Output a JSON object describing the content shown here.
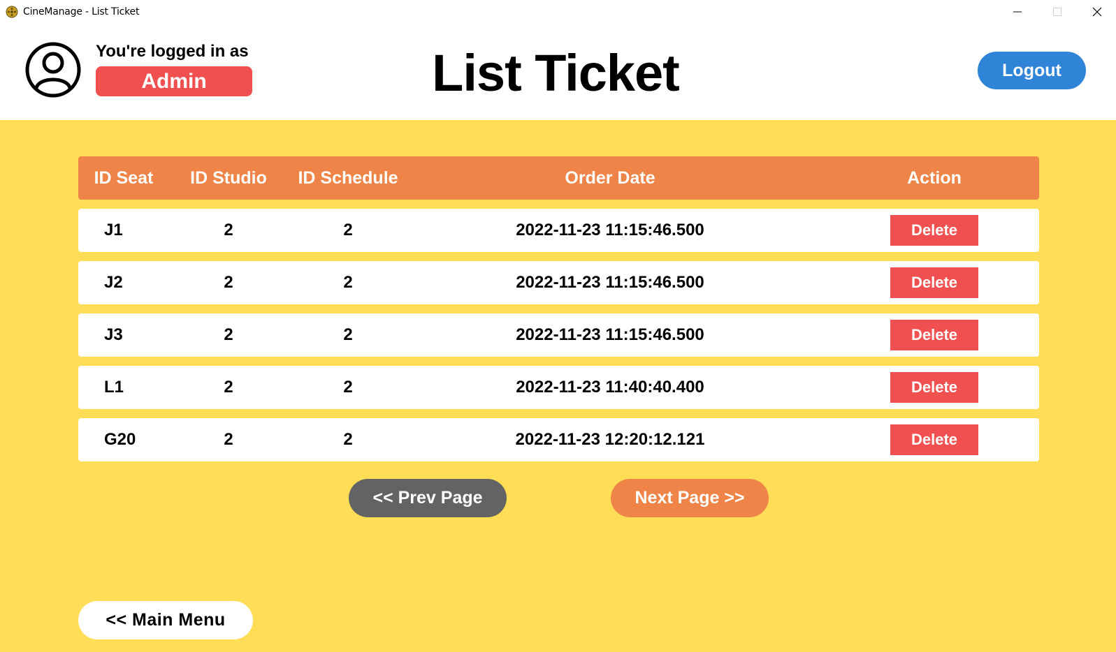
{
  "window": {
    "title": "CineManage - List Ticket",
    "icon": "film-reel-icon"
  },
  "header": {
    "logged_in_label": "You're logged in as",
    "role": "Admin",
    "page_title": "List Ticket",
    "logout_label": "Logout",
    "avatar_icon": "user-circle-icon"
  },
  "table": {
    "columns": [
      "ID Seat",
      "ID Studio",
      "ID Schedule",
      "Order Date",
      "Action"
    ],
    "rows": [
      {
        "seat": "J1",
        "studio": "2",
        "schedule": "2",
        "order_date": "2022-11-23 11:15:46.500",
        "action": "Delete"
      },
      {
        "seat": "J2",
        "studio": "2",
        "schedule": "2",
        "order_date": "2022-11-23 11:15:46.500",
        "action": "Delete"
      },
      {
        "seat": "J3",
        "studio": "2",
        "schedule": "2",
        "order_date": "2022-11-23 11:15:46.500",
        "action": "Delete"
      },
      {
        "seat": "L1",
        "studio": "2",
        "schedule": "2",
        "order_date": "2022-11-23 11:40:40.400",
        "action": "Delete"
      },
      {
        "seat": "G20",
        "studio": "2",
        "schedule": "2",
        "order_date": "2022-11-23 12:20:12.121",
        "action": "Delete"
      }
    ]
  },
  "pagination": {
    "prev_label": "<< Prev Page",
    "next_label": "Next Page >>"
  },
  "footer": {
    "main_menu_label": "<< Main Menu"
  },
  "colors": {
    "background": "#ffdd57",
    "table_header": "#ee8447",
    "delete": "#f05050",
    "logout": "#2f84d8",
    "prev": "#636363"
  }
}
